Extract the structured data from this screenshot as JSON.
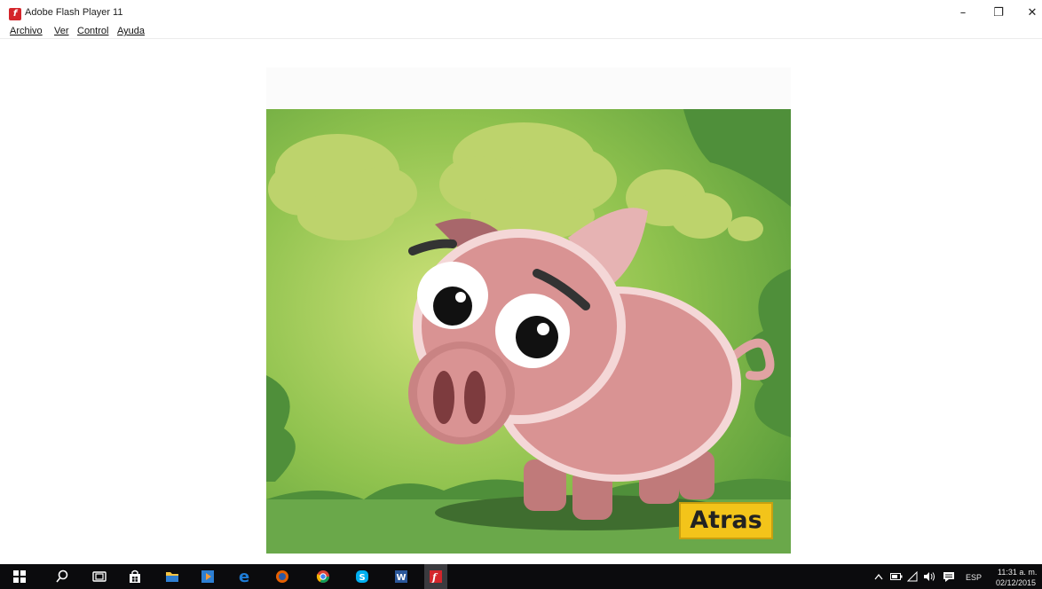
{
  "window": {
    "title": "Adobe Flash Player 11",
    "minimize_glyph": "–",
    "restore_glyph": "❐",
    "close_glyph": "✕"
  },
  "menu": {
    "items": [
      {
        "label": "Archivo"
      },
      {
        "label": "Ver"
      },
      {
        "label": "Control"
      },
      {
        "label": "Ayuda"
      }
    ]
  },
  "content": {
    "back_button_label": "Atras"
  },
  "taskbar": {
    "apps": [
      {
        "name": "start",
        "icon": "windows-icon",
        "color": "#ffffff"
      },
      {
        "name": "search",
        "icon": "search-icon",
        "color": "#ffffff"
      },
      {
        "name": "task-view",
        "icon": "task-view-icon",
        "color": "#ffffff"
      },
      {
        "name": "store",
        "icon": "store-icon",
        "color": "#ffffff"
      },
      {
        "name": "file-explorer",
        "icon": "folder-icon",
        "color": "#f6c342"
      },
      {
        "name": "media",
        "icon": "media-icon",
        "color": "#2d7fd3"
      },
      {
        "name": "edge",
        "icon": "edge-icon",
        "color": "#1e7cd6"
      },
      {
        "name": "firefox",
        "icon": "firefox-icon",
        "color": "#e66000"
      },
      {
        "name": "chrome",
        "icon": "chrome-icon",
        "color": "#4caf50"
      },
      {
        "name": "skype",
        "icon": "skype-icon",
        "color": "#00aff0"
      },
      {
        "name": "word",
        "icon": "word-icon",
        "color": "#2b579a"
      },
      {
        "name": "flash",
        "icon": "flash-icon",
        "color": "#d4252b"
      }
    ],
    "tray": {
      "language": "ESP",
      "time": "11:31 a. m.",
      "date": "02/12/2015"
    }
  },
  "colors": {
    "flash_red": "#d4252b",
    "button_yellow": "#f3c41a",
    "taskbar": "#0b0b0d"
  }
}
